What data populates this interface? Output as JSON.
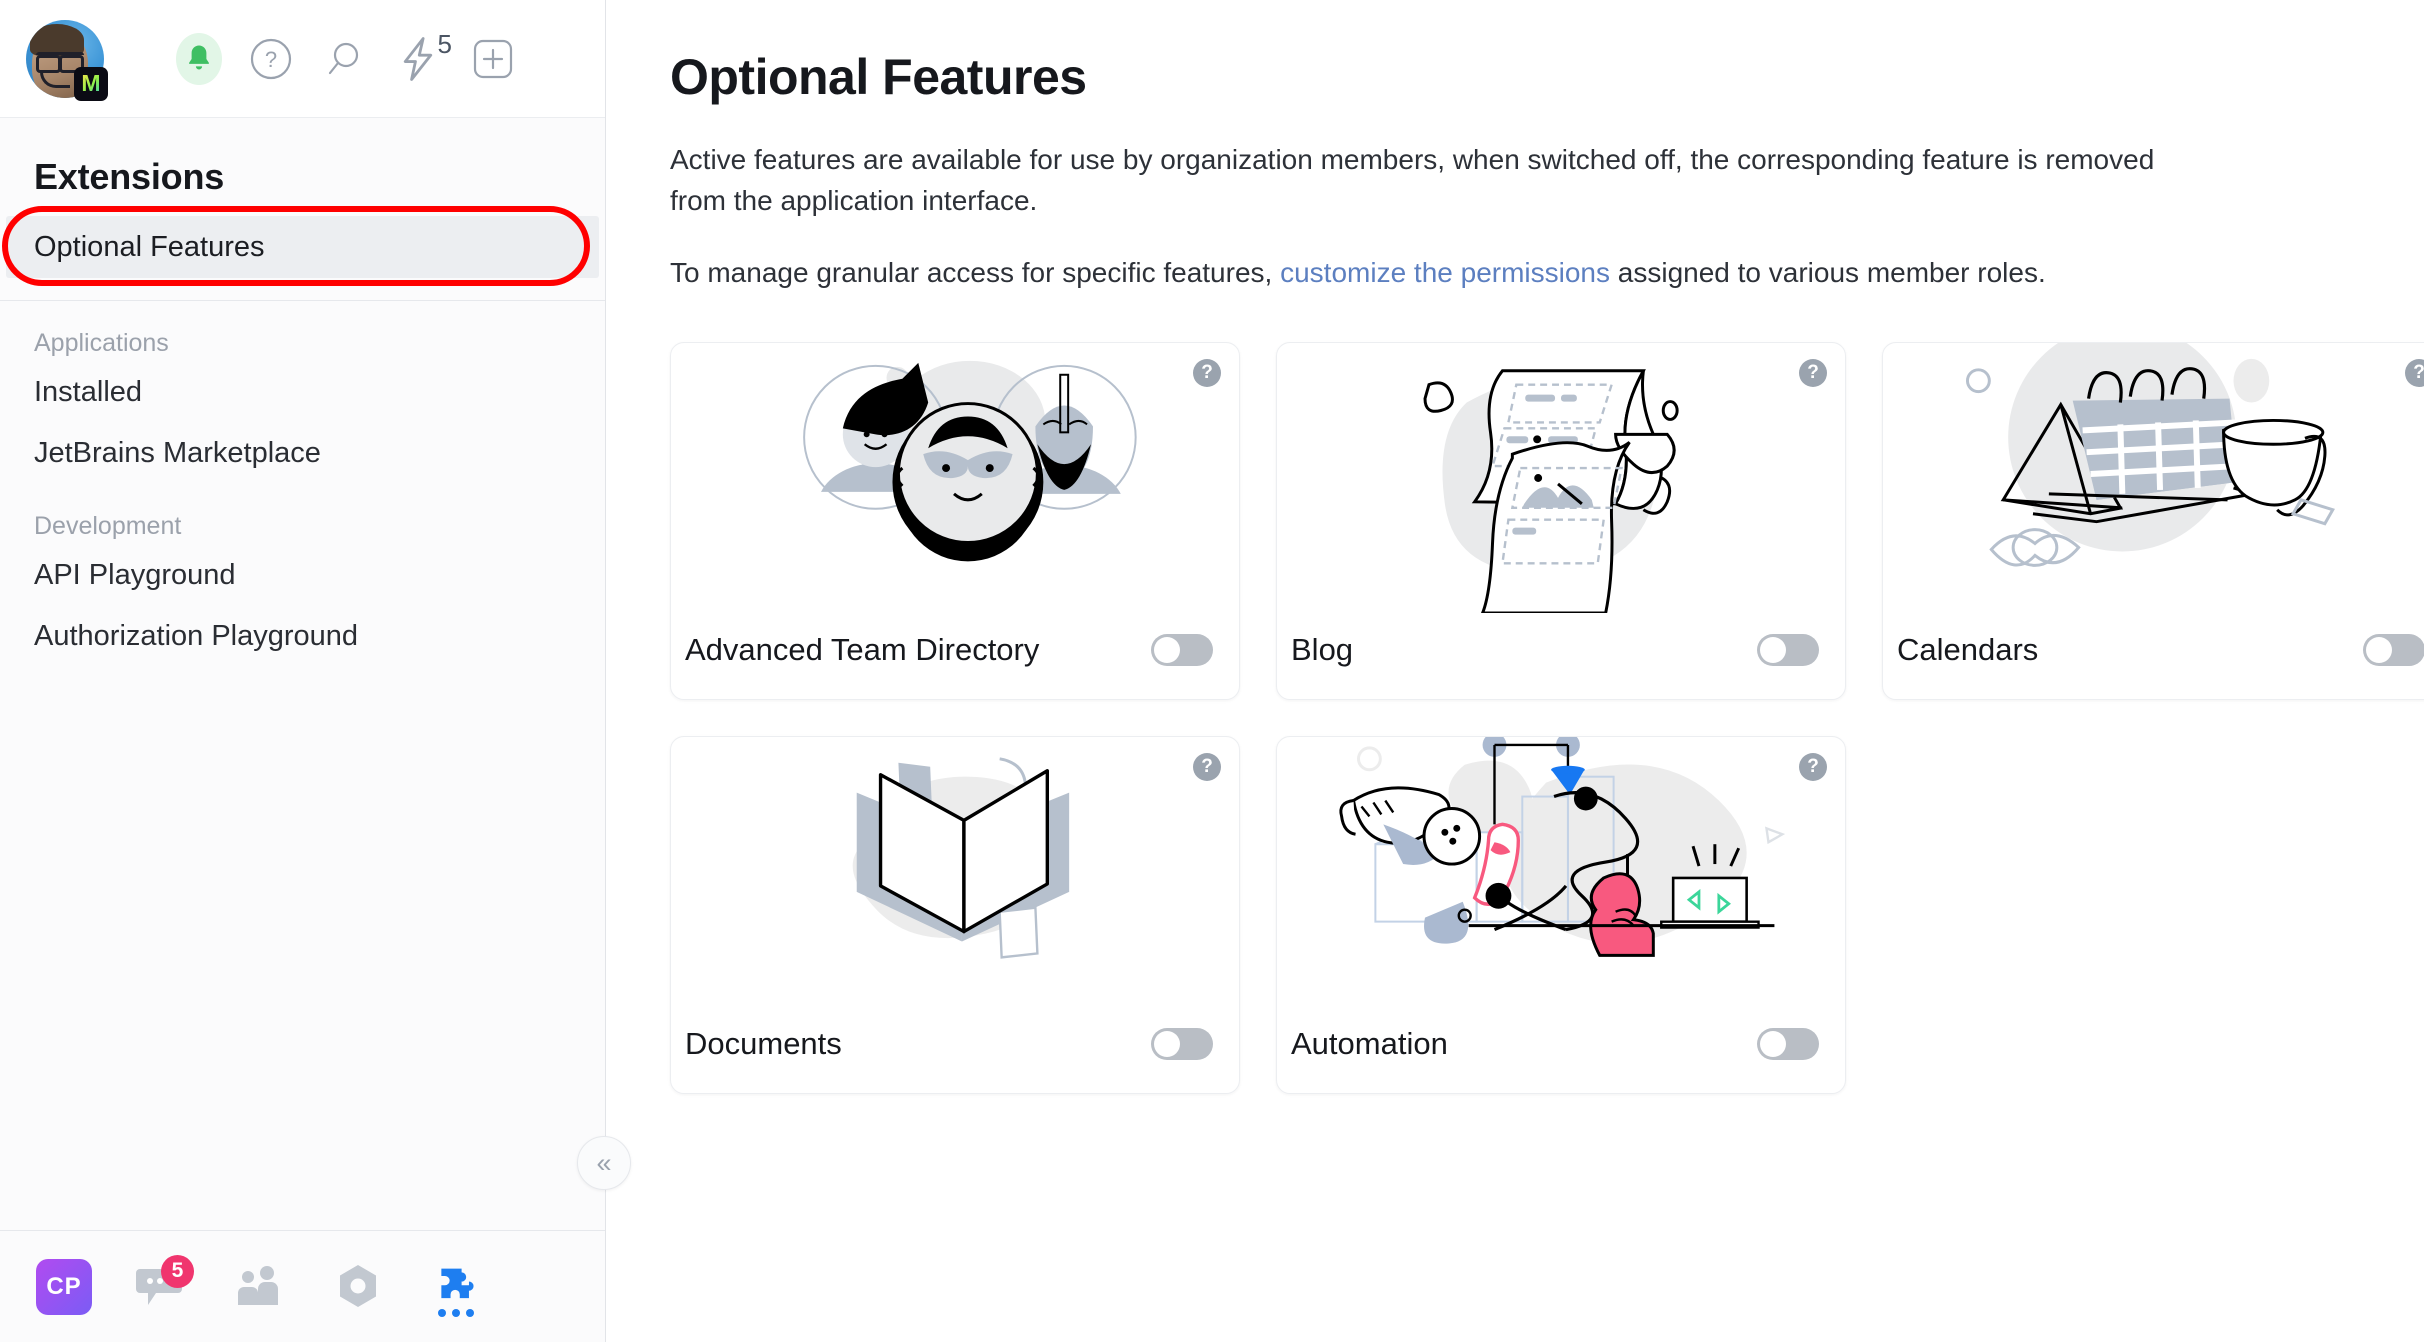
{
  "topbar": {
    "avatar_name": "user-avatar",
    "badge_logo": "M",
    "icons": [
      {
        "name": "bell-icon",
        "label": "Notifications"
      },
      {
        "name": "help-circle-icon",
        "label": "?"
      },
      {
        "name": "search-icon",
        "label": "Search"
      },
      {
        "name": "lightning-icon",
        "label": "Automation",
        "count": "5"
      },
      {
        "name": "plus-box-icon",
        "label": "Create"
      }
    ]
  },
  "sidebar": {
    "title": "Extensions",
    "active_item": "Optional Features",
    "groups": [
      {
        "label": "Applications",
        "items": [
          "Installed",
          "JetBrains Marketplace"
        ]
      },
      {
        "label": "Development",
        "items": [
          "API Playground",
          "Authorization Playground"
        ]
      }
    ],
    "collapse_label": "«",
    "bottom": {
      "profile_initials": "CP",
      "chat_badge": "5",
      "items": [
        {
          "name": "chat-icon"
        },
        {
          "name": "team-icon"
        },
        {
          "name": "hexagon-icon"
        },
        {
          "name": "puzzle-icon"
        }
      ]
    }
  },
  "main": {
    "title": "Optional Features",
    "paragraph1": "Active features are available for use by organization members, when switched off, the corresponding feature is removed from the application interface.",
    "paragraph2_before": "To manage granular access for specific features, ",
    "paragraph2_link": "customize the permissions",
    "paragraph2_after": " assigned to various member roles.",
    "help_glyph": "?",
    "cards": [
      {
        "title": "Advanced Team Directory",
        "enabled": false,
        "art": "team-directory-illustration"
      },
      {
        "title": "Blog",
        "enabled": false,
        "art": "blog-illustration"
      },
      {
        "title": "Calendars",
        "enabled": false,
        "art": "calendars-illustration"
      },
      {
        "title": "Documents",
        "enabled": false,
        "art": "documents-illustration"
      },
      {
        "title": "Automation",
        "enabled": false,
        "art": "automation-illustration"
      }
    ]
  },
  "colors": {
    "highlight_box": "#ff0000",
    "link": "#5c7fc0",
    "toggle_off": "#b9bec5",
    "badge_red": "#f0356e",
    "accent_blue": "#1e7ef0"
  }
}
